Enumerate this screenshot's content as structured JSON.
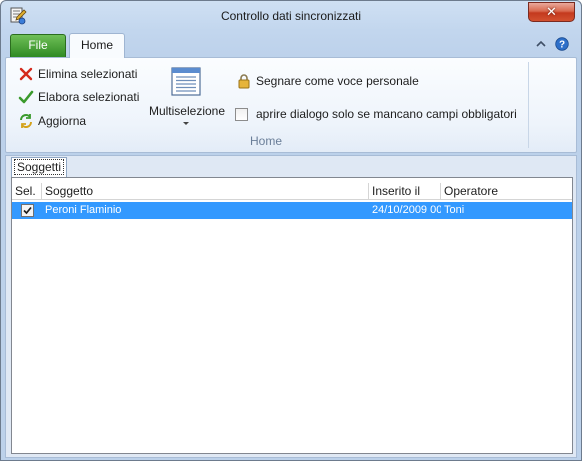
{
  "window": {
    "title": "Controllo dati sincronizzati",
    "close_glyph": "✕"
  },
  "ribbon": {
    "tabs": [
      {
        "label": "File",
        "selected": false
      },
      {
        "label": "Home",
        "selected": true
      }
    ],
    "commands": {
      "elimina": "Elimina selezionati",
      "elabora": "Elabora selezionati",
      "aggiorna": "Aggiorna"
    },
    "multiselezione_label": "Multiselezione",
    "segnare_label": "Segnare come voce personale",
    "aprire_label": "aprire dialogo solo se mancano campi obbligatori",
    "aprire_checked": false,
    "group_label": "Home"
  },
  "content": {
    "tab_label": "Soggetti",
    "columns": [
      "Sel.",
      "Soggetto",
      "Inserito il",
      "Operatore"
    ],
    "rows": [
      {
        "checked": true,
        "soggetto": "Peroni Flaminio",
        "inserito": "24/10/2009 00",
        "operatore": "Toni"
      }
    ]
  },
  "colors": {
    "selection": "#3399ff",
    "file_tab": "#3a9a2c",
    "close_button": "#c4391e"
  }
}
